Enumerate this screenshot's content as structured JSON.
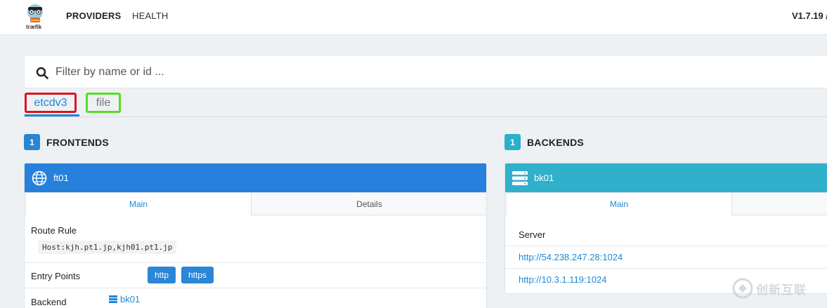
{
  "nav": {
    "logo_text": "træfik",
    "providers_label": "PROVIDERS",
    "health_label": "HEALTH",
    "version": "V1.7.19 /"
  },
  "search": {
    "placeholder": "Filter by name or id ..."
  },
  "provider_tabs": [
    {
      "label": "etcdv3",
      "active": true,
      "outline_color": "#e0111a"
    },
    {
      "label": "file",
      "active": false,
      "outline_color": "#55dd22"
    }
  ],
  "frontends": {
    "count": "1",
    "title": "FRONTENDS",
    "card": {
      "name": "ft01",
      "icon": "globe-icon",
      "tabs": [
        "Main",
        "Details"
      ],
      "route_rule_label": "Route Rule",
      "route_rule_value": "Host:kjh.pt1.jp,kjh01.pt1.jp",
      "entry_points_label": "Entry Points",
      "entry_points": [
        "http",
        "https"
      ],
      "backend_label": "Backend",
      "backend_value": "bk01",
      "backend_icon": "server-icon"
    }
  },
  "backends": {
    "count": "1",
    "title": "BACKENDS",
    "card": {
      "name": "bk01",
      "icon": "server-icon",
      "tabs": [
        "Main"
      ],
      "server_label": "Server",
      "servers": [
        "http://54.238.247.28:1024",
        "http://10.3.1.119:1024"
      ]
    }
  },
  "watermark": {
    "text": "创新互联"
  },
  "colors": {
    "frontend_header": "#2680dc",
    "backend_header": "#30b0ca",
    "link": "#1e88d6"
  }
}
